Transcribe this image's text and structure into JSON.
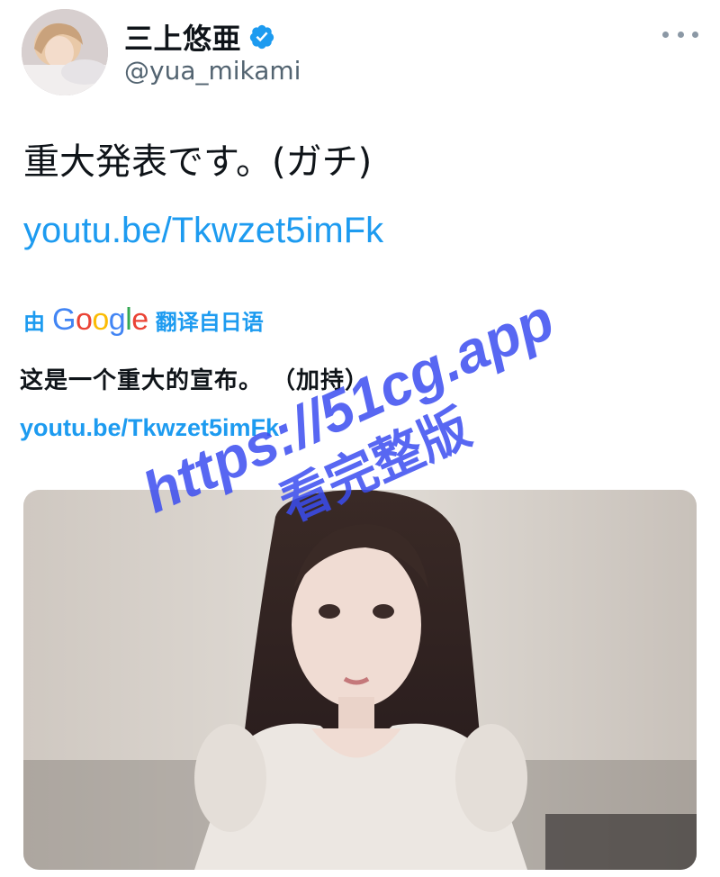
{
  "author": {
    "display_name": "三上悠亜",
    "handle": "@yua_mikami",
    "verified": true
  },
  "tweet": {
    "text": "重大発表です。(ガチ)",
    "link": "youtu.be/Tkwzet5imFk"
  },
  "translation": {
    "prefix": "由",
    "provider": "Google",
    "suffix": "翻译自日语",
    "text": "这是一个重大的宣布。 （加持）",
    "link": "youtu.be/Tkwzet5imFk"
  },
  "watermark": {
    "line1": "https://51cg.app",
    "line2": "看完整版",
    "color": "#3b4cf0"
  },
  "colors": {
    "link": "#1d9bf0",
    "handle": "#536471",
    "text": "#0f1419"
  }
}
